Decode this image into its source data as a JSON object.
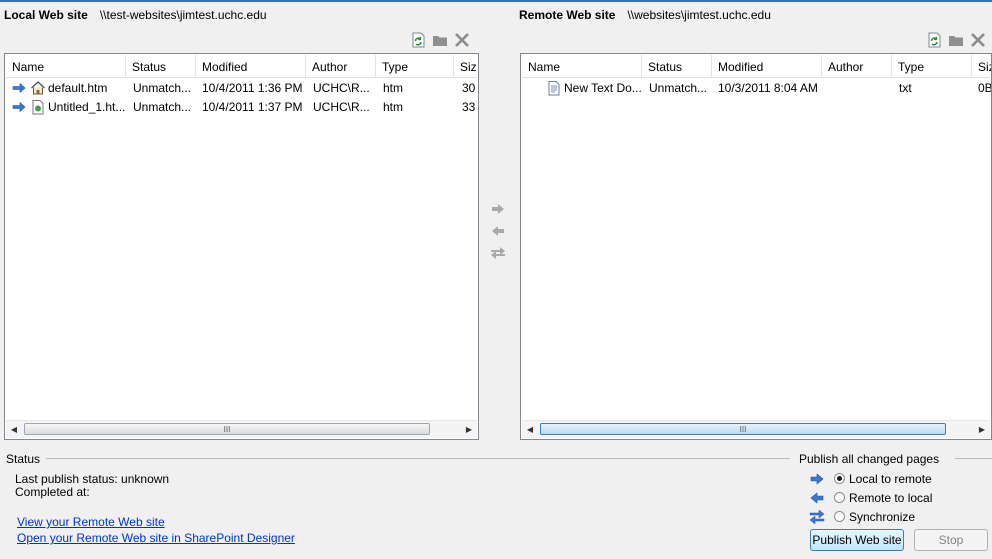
{
  "colors": {
    "accent": "#3c6fb4",
    "link": "#0033cc"
  },
  "local": {
    "title": "Local Web site",
    "path": "\\\\test-websites\\jimtest.uchc.edu",
    "toolbar": [
      "refresh-icon",
      "new-folder-icon",
      "delete-icon"
    ],
    "columns": [
      "Name",
      "Status",
      "Modified",
      "Author",
      "Type",
      "Siz"
    ],
    "rows": [
      {
        "arrow": "right-arrow-icon",
        "icon": "home-page-icon",
        "name": "default.htm",
        "status": "Unmatch...",
        "modified": "10/4/2011 1:36 PM",
        "author": "UCHC\\R...",
        "type": "htm",
        "size": "30"
      },
      {
        "arrow": "right-arrow-icon",
        "icon": "web-page-icon",
        "name": "Untitled_1.ht...",
        "status": "Unmatch...",
        "modified": "10/4/2011 1:37 PM",
        "author": "UCHC\\R...",
        "type": "htm",
        "size": "33"
      }
    ],
    "scroll_grip": "III"
  },
  "remote": {
    "title": "Remote Web site",
    "path": "\\\\websites\\jimtest.uchc.edu",
    "toolbar": [
      "refresh-icon",
      "new-folder-icon",
      "delete-icon"
    ],
    "columns": [
      "Name",
      "Status",
      "Modified",
      "Author",
      "Type",
      "Siz"
    ],
    "rows": [
      {
        "icon": "text-document-icon",
        "name": "New Text Do...",
        "status": "Unmatch...",
        "modified": "10/3/2011 8:04 AM",
        "author": "",
        "type": "txt",
        "size": "0B"
      }
    ],
    "scroll_grip": "III"
  },
  "transfer": [
    "copy-right-icon",
    "copy-left-icon",
    "synchronize-icon"
  ],
  "status": {
    "title": "Status",
    "last_publish": "Last publish status: unknown",
    "completed": "Completed at:",
    "link_view": "View your Remote Web site",
    "link_open": "Open your Remote Web site in SharePoint Designer"
  },
  "publish": {
    "title": "Publish all changed pages",
    "options": [
      {
        "label": "Local to remote",
        "selected": true,
        "icon": "right-arrow-icon"
      },
      {
        "label": "Remote to local",
        "selected": false,
        "icon": "left-arrow-icon"
      },
      {
        "label": "Synchronize",
        "selected": false,
        "icon": "synchronize-icon"
      }
    ],
    "publish_button": "Publish Web site",
    "stop_button": "Stop"
  }
}
